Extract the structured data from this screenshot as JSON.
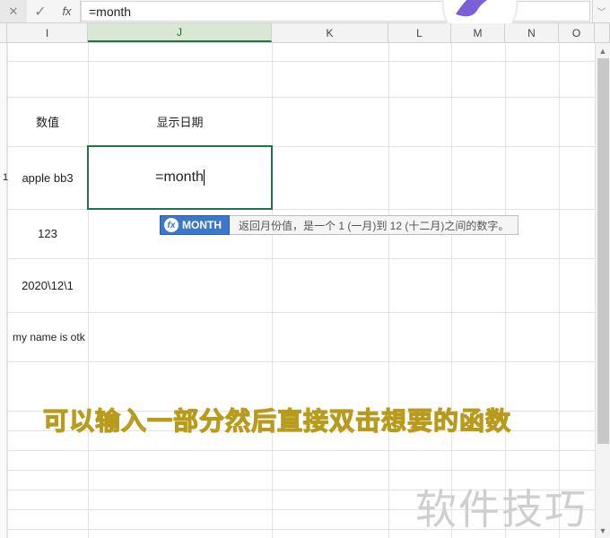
{
  "formula_bar": {
    "cancel_glyph": "✕",
    "accept_glyph": "✓",
    "fx_label": "fx",
    "value": "=month",
    "dropdown_glyph": "﹀"
  },
  "columns": {
    "I": "I",
    "J": "J",
    "K": "K",
    "L": "L",
    "M": "M",
    "N": "N",
    "O": "O"
  },
  "cells": {
    "I_header": "数值",
    "J_header": "显示日期",
    "row1_num": "1",
    "row1_I": "apple bb3",
    "row2_I": "123",
    "row3_I": "2020\\12\\1",
    "row4_I": "my name is otk",
    "active_J_value": "=month"
  },
  "function_hint": {
    "name": "MONTH",
    "icon_glyph": "fx",
    "description": "返回月份值，是一个 1 (一月)到 12 (十二月)之间的数字。"
  },
  "annotation_text": "可以输入一部分然后直接双击想要的函数",
  "watermark_text": "软件技巧",
  "scroll": {
    "up_glyph": "▲",
    "down_glyph": "▼"
  }
}
